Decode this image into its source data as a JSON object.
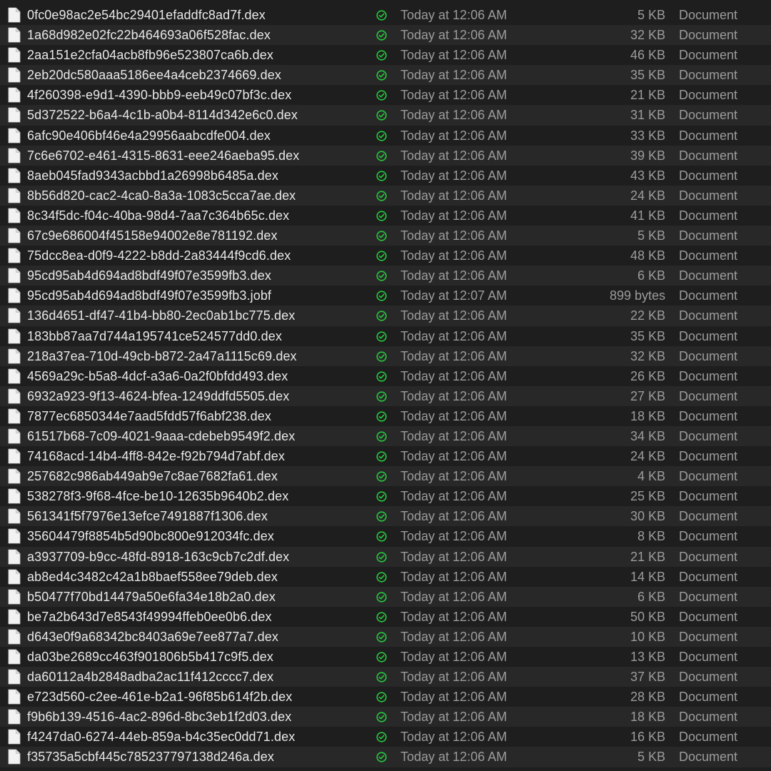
{
  "colors": {
    "background": "#1e1e1e",
    "row_alt": "#282828",
    "text_primary": "#e8e8e8",
    "text_secondary": "#9c9c9c",
    "status_green": "#27c93f"
  },
  "icons": {
    "file": "document-icon",
    "status": "checkmark-circle-icon"
  },
  "files": [
    {
      "name": "0fc0e98ac2e54bc29401efaddfc8ad7f.dex",
      "date": "Today at 12:06 AM",
      "size": "5 KB",
      "kind": "Document"
    },
    {
      "name": "1a68d982e02fc22b464693a06f528fac.dex",
      "date": "Today at 12:06 AM",
      "size": "32 KB",
      "kind": "Document"
    },
    {
      "name": "2aa151e2cfa04acb8fb96e523807ca6b.dex",
      "date": "Today at 12:06 AM",
      "size": "46 KB",
      "kind": "Document"
    },
    {
      "name": "2eb20dc580aaa5186ee4a4ceb2374669.dex",
      "date": "Today at 12:06 AM",
      "size": "35 KB",
      "kind": "Document"
    },
    {
      "name": "4f260398-e9d1-4390-bbb9-eeb49c07bf3c.dex",
      "date": "Today at 12:06 AM",
      "size": "21 KB",
      "kind": "Document"
    },
    {
      "name": "5d372522-b6a4-4c1b-a0b4-8114d342e6c0.dex",
      "date": "Today at 12:06 AM",
      "size": "31 KB",
      "kind": "Document"
    },
    {
      "name": "6afc90e406bf46e4a29956aabcdfe004.dex",
      "date": "Today at 12:06 AM",
      "size": "33 KB",
      "kind": "Document"
    },
    {
      "name": "7c6e6702-e461-4315-8631-eee246aeba95.dex",
      "date": "Today at 12:06 AM",
      "size": "39 KB",
      "kind": "Document"
    },
    {
      "name": "8aeb045fad9343acbbd1a26998b6485a.dex",
      "date": "Today at 12:06 AM",
      "size": "43 KB",
      "kind": "Document"
    },
    {
      "name": "8b56d820-cac2-4ca0-8a3a-1083c5cca7ae.dex",
      "date": "Today at 12:06 AM",
      "size": "24 KB",
      "kind": "Document"
    },
    {
      "name": "8c34f5dc-f04c-40ba-98d4-7aa7c364b65c.dex",
      "date": "Today at 12:06 AM",
      "size": "41 KB",
      "kind": "Document"
    },
    {
      "name": "67c9e686004f45158e94002e8e781192.dex",
      "date": "Today at 12:06 AM",
      "size": "5 KB",
      "kind": "Document"
    },
    {
      "name": "75dcc8ea-d0f9-4222-b8dd-2a83444f9cd6.dex",
      "date": "Today at 12:06 AM",
      "size": "48 KB",
      "kind": "Document"
    },
    {
      "name": "95cd95ab4d694ad8bdf49f07e3599fb3.dex",
      "date": "Today at 12:06 AM",
      "size": "6 KB",
      "kind": "Document"
    },
    {
      "name": "95cd95ab4d694ad8bdf49f07e3599fb3.jobf",
      "date": "Today at 12:07 AM",
      "size": "899 bytes",
      "kind": "Document"
    },
    {
      "name": "136d4651-df47-41b4-bb80-2ec0ab1bc775.dex",
      "date": "Today at 12:06 AM",
      "size": "22 KB",
      "kind": "Document"
    },
    {
      "name": "183bb87aa7d744a195741ce524577dd0.dex",
      "date": "Today at 12:06 AM",
      "size": "35 KB",
      "kind": "Document"
    },
    {
      "name": "218a37ea-710d-49cb-b872-2a47a1115c69.dex",
      "date": "Today at 12:06 AM",
      "size": "32 KB",
      "kind": "Document"
    },
    {
      "name": "4569a29c-b5a8-4dcf-a3a6-0a2f0bfdd493.dex",
      "date": "Today at 12:06 AM",
      "size": "26 KB",
      "kind": "Document"
    },
    {
      "name": "6932a923-9f13-4624-bfea-1249ddfd5505.dex",
      "date": "Today at 12:06 AM",
      "size": "27 KB",
      "kind": "Document"
    },
    {
      "name": "7877ec6850344e7aad5fdd57f6abf238.dex",
      "date": "Today at 12:06 AM",
      "size": "18 KB",
      "kind": "Document"
    },
    {
      "name": "61517b68-7c09-4021-9aaa-cdebeb9549f2.dex",
      "date": "Today at 12:06 AM",
      "size": "34 KB",
      "kind": "Document"
    },
    {
      "name": "74168acd-14b4-4ff8-842e-f92b794d7abf.dex",
      "date": "Today at 12:06 AM",
      "size": "24 KB",
      "kind": "Document"
    },
    {
      "name": "257682c986ab449ab9e7c8ae7682fa61.dex",
      "date": "Today at 12:06 AM",
      "size": "4 KB",
      "kind": "Document"
    },
    {
      "name": "538278f3-9f68-4fce-be10-12635b9640b2.dex",
      "date": "Today at 12:06 AM",
      "size": "25 KB",
      "kind": "Document"
    },
    {
      "name": "561341f5f7976e13efce7491887f1306.dex",
      "date": "Today at 12:06 AM",
      "size": "30 KB",
      "kind": "Document"
    },
    {
      "name": "35604479f8854b5d90bc800e912034fc.dex",
      "date": "Today at 12:06 AM",
      "size": "8 KB",
      "kind": "Document"
    },
    {
      "name": "a3937709-b9cc-48fd-8918-163c9cb7c2df.dex",
      "date": "Today at 12:06 AM",
      "size": "21 KB",
      "kind": "Document"
    },
    {
      "name": "ab8ed4c3482c42a1b8baef558ee79deb.dex",
      "date": "Today at 12:06 AM",
      "size": "14 KB",
      "kind": "Document"
    },
    {
      "name": "b50477f70bd14479a50e6fa34e18b2a0.dex",
      "date": "Today at 12:06 AM",
      "size": "6 KB",
      "kind": "Document"
    },
    {
      "name": "be7a2b643d7e8543f49994ffeb0ee0b6.dex",
      "date": "Today at 12:06 AM",
      "size": "50 KB",
      "kind": "Document"
    },
    {
      "name": "d643e0f9a68342bc8403a69e7ee877a7.dex",
      "date": "Today at 12:06 AM",
      "size": "10 KB",
      "kind": "Document"
    },
    {
      "name": "da03be2689cc463f901806b5b417c9f5.dex",
      "date": "Today at 12:06 AM",
      "size": "13 KB",
      "kind": "Document"
    },
    {
      "name": "da60112a4b2848adba2ac11f412cccc7.dex",
      "date": "Today at 12:06 AM",
      "size": "37 KB",
      "kind": "Document"
    },
    {
      "name": "e723d560-c2ee-461e-b2a1-96f85b614f2b.dex",
      "date": "Today at 12:06 AM",
      "size": "28 KB",
      "kind": "Document"
    },
    {
      "name": "f9b6b139-4516-4ac2-896d-8bc3eb1f2d03.dex",
      "date": "Today at 12:06 AM",
      "size": "18 KB",
      "kind": "Document"
    },
    {
      "name": "f4247da0-6274-44eb-859a-b4c35ec0dd71.dex",
      "date": "Today at 12:06 AM",
      "size": "16 KB",
      "kind": "Document"
    },
    {
      "name": "f35735a5cbf445c785237797138d246a.dex",
      "date": "Today at 12:06 AM",
      "size": "5 KB",
      "kind": "Document"
    }
  ]
}
